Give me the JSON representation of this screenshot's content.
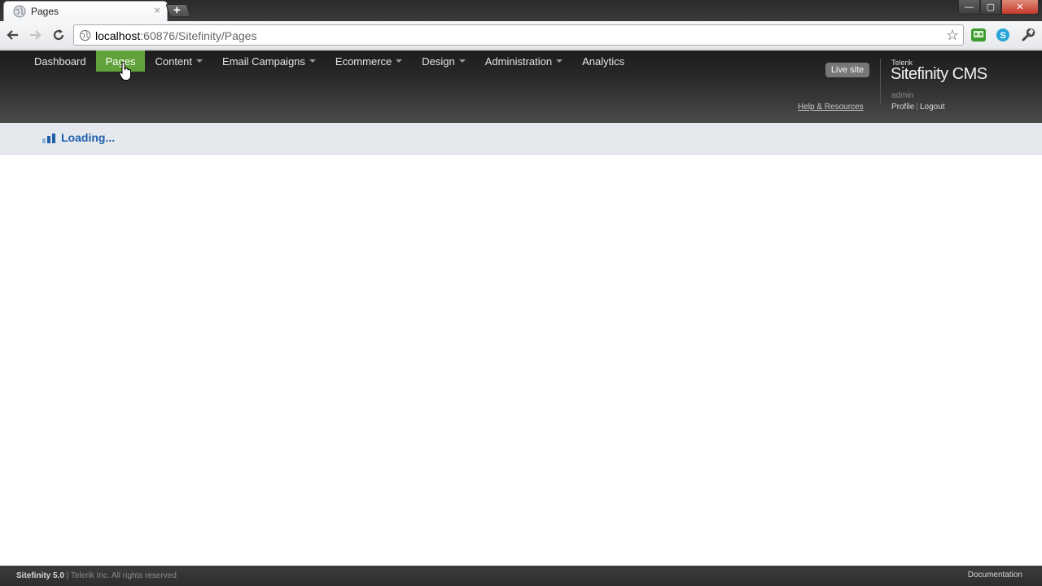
{
  "browser": {
    "tab_title": "Pages",
    "tab_close": "×",
    "new_tab": "+",
    "url_host": "localhost",
    "url_rest": ":60876/Sitefinity/Pages",
    "window_controls": {
      "minimize": "—",
      "maximize": "▢",
      "close": "✕"
    }
  },
  "nav": {
    "items": [
      {
        "label": "Dashboard",
        "has_menu": false,
        "active": false
      },
      {
        "label": "Pages",
        "has_menu": false,
        "active": true
      },
      {
        "label": "Content",
        "has_menu": true,
        "active": false
      },
      {
        "label": "Email Campaigns",
        "has_menu": true,
        "active": false
      },
      {
        "label": "Ecommerce",
        "has_menu": true,
        "active": false
      },
      {
        "label": "Design",
        "has_menu": true,
        "active": false
      },
      {
        "label": "Administration",
        "has_menu": true,
        "active": false
      },
      {
        "label": "Analytics",
        "has_menu": false,
        "active": false
      }
    ]
  },
  "header": {
    "live_site": "Live site",
    "brand_small": "Telerik",
    "brand_big": "Sitefinity CMS",
    "username": "admin",
    "help": "Help & Resources",
    "profile": "Profile",
    "separator": "|",
    "logout": "Logout"
  },
  "loading": {
    "text": "Loading..."
  },
  "footer": {
    "product": "Sitefinity 5.0",
    "copyright": " | Telerik Inc. All rights reserved",
    "documentation": "Documentation"
  },
  "colors": {
    "active_nav": "#62a23a",
    "loading_text": "#1e5fa8",
    "header_dark": "#2a2a2a"
  }
}
